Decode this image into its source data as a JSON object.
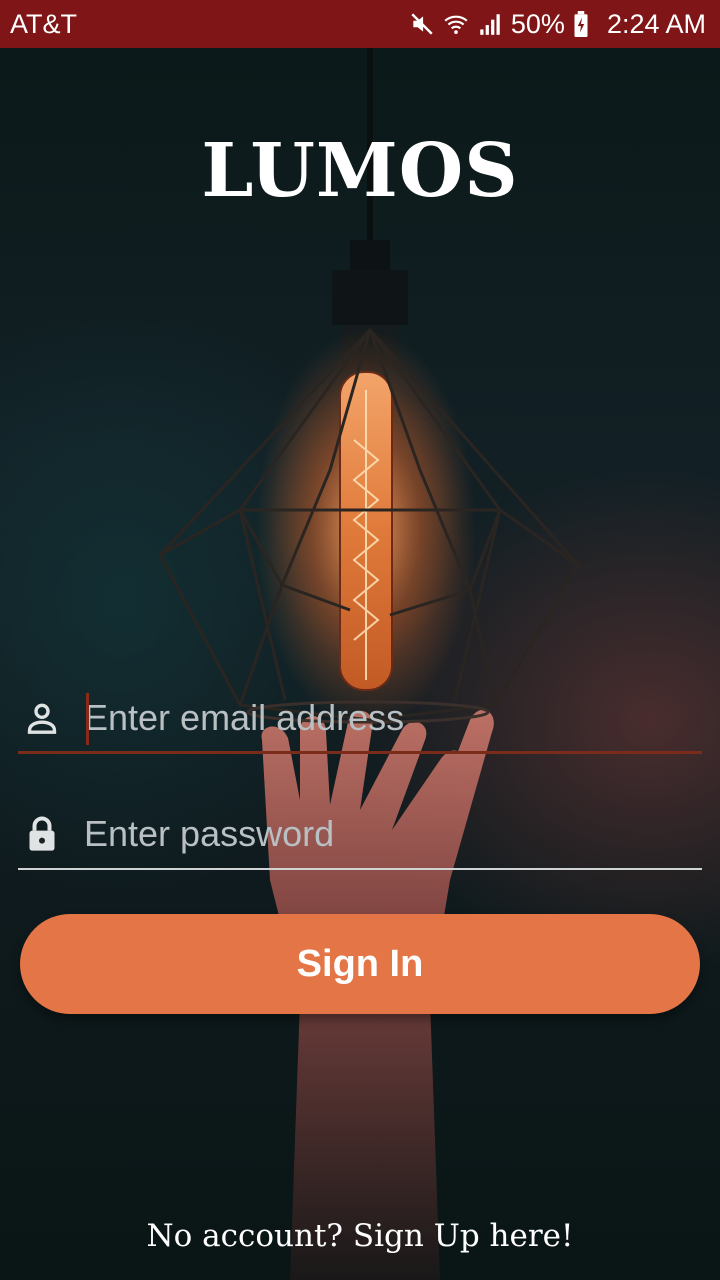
{
  "status_bar": {
    "carrier": "AT&T",
    "battery": "50%",
    "time": "2:24 AM",
    "icons": [
      "mute-icon",
      "wifi-icon",
      "signal-icon",
      "battery-icon"
    ]
  },
  "app": {
    "title": "LUMOS"
  },
  "login": {
    "email_placeholder": "Enter email address",
    "email_value": "",
    "password_placeholder": "Enter password",
    "password_value": "",
    "sign_in_label": "Sign In",
    "signup_text": "No account? Sign Up here!"
  },
  "colors": {
    "status_bar": "#7f1517",
    "accent": "#e37546",
    "email_underline": "#7a2b19",
    "password_underline": "#cfd3d4"
  }
}
